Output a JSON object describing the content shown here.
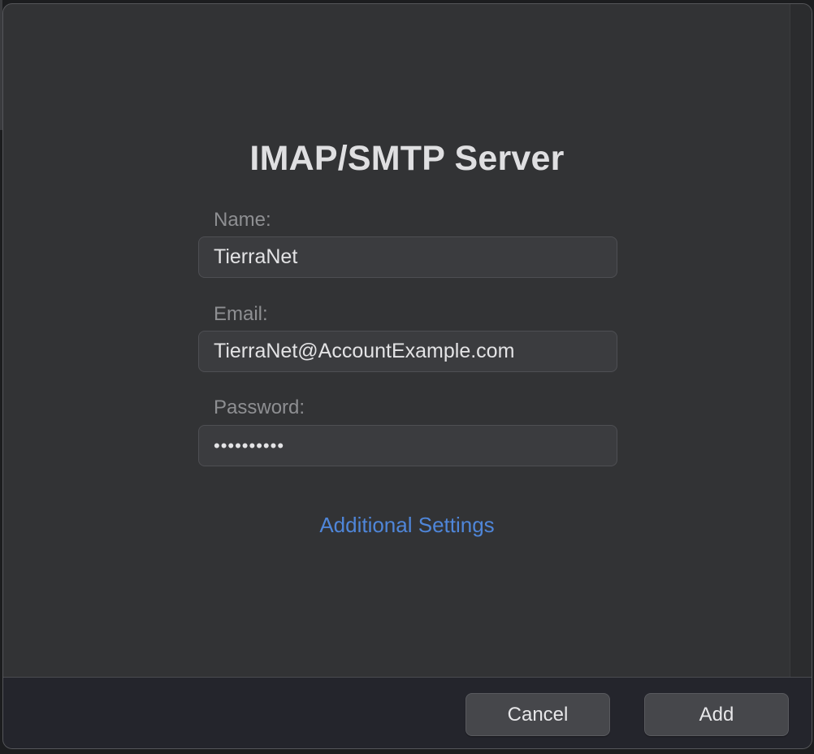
{
  "dialog": {
    "title": "IMAP/SMTP Server",
    "fields": {
      "name": {
        "label": "Name:",
        "value": "TierraNet"
      },
      "email": {
        "label": "Email:",
        "value": "TierraNet@AccountExample.com"
      },
      "password": {
        "label": "Password:",
        "value": "••••••••••"
      }
    },
    "additional_settings_link": "Additional Settings",
    "buttons": {
      "cancel": "Cancel",
      "add": "Add"
    }
  },
  "colors": {
    "window_bg": "#323335",
    "footer_bg": "#24252c",
    "field_bg": "#3b3c3f",
    "link": "#4f86d9",
    "title_text": "#dfdfe1",
    "label_text": "#8e8f92"
  }
}
